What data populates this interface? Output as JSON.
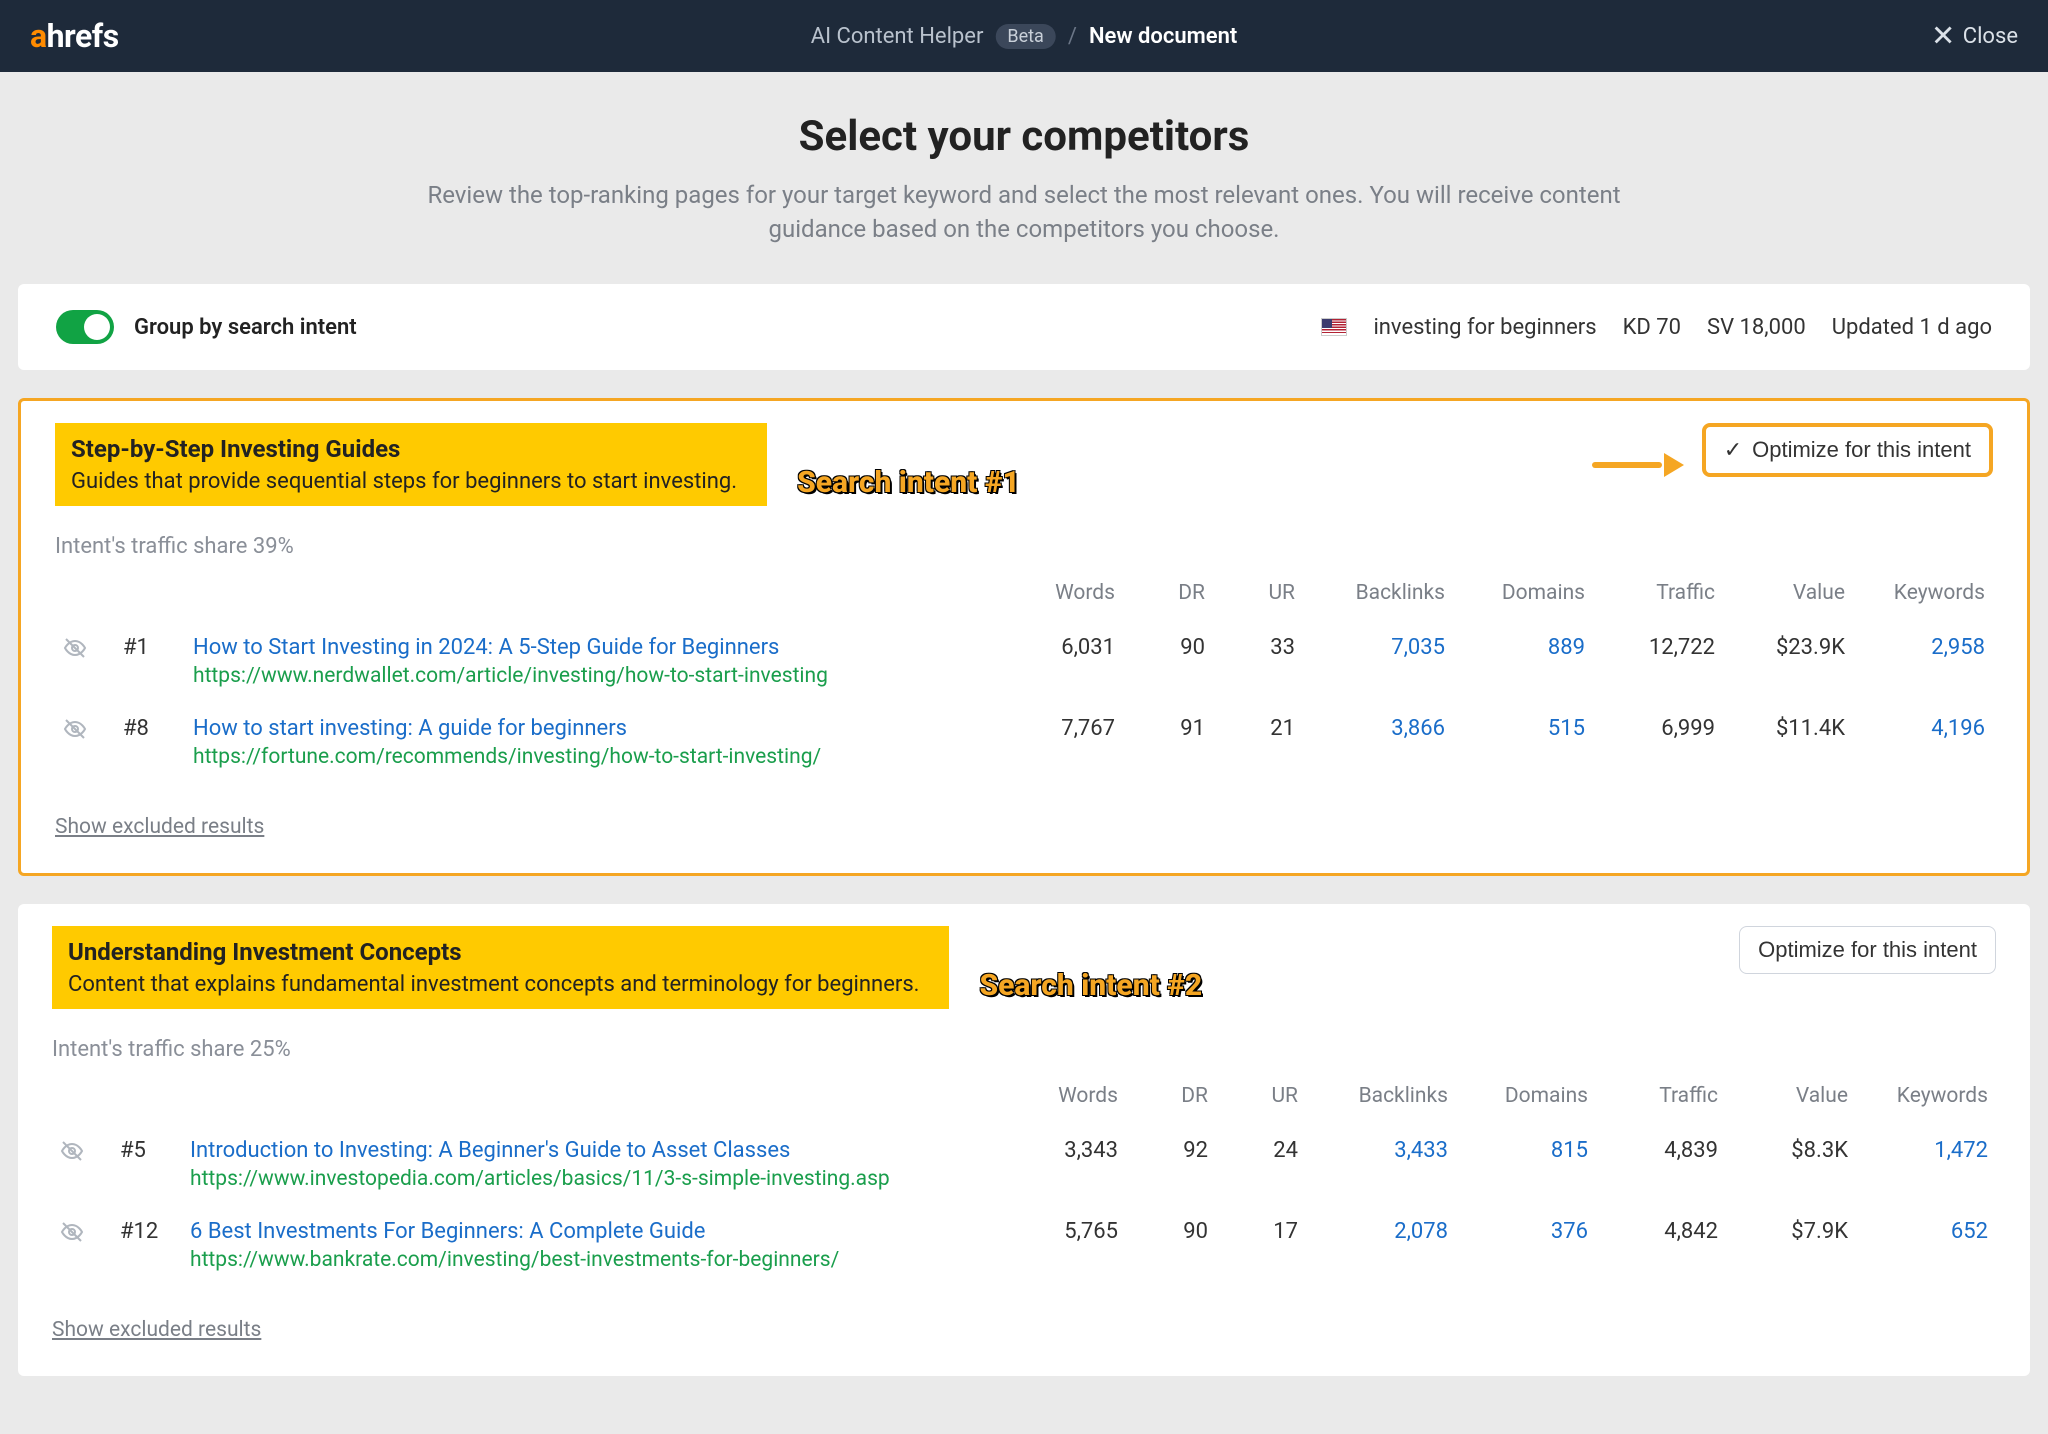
{
  "header": {
    "logo_a": "a",
    "logo_rest": "hrefs",
    "breadcrumb_tool": "AI Content Helper",
    "beta": "Beta",
    "breadcrumb_current": "New document",
    "close": "Close"
  },
  "hero": {
    "title": "Select your competitors",
    "subtitle": "Review the top-ranking pages for your target keyword and select the most relevant ones. You will receive content guidance based on the competitors you choose."
  },
  "controls": {
    "toggle_label": "Group by search intent",
    "keyword": "investing for beginners",
    "kd": "KD 70",
    "sv": "SV 18,000",
    "updated": "Updated 1 d ago"
  },
  "columns": {
    "words": "Words",
    "dr": "DR",
    "ur": "UR",
    "backlinks": "Backlinks",
    "domains": "Domains",
    "traffic": "Traffic",
    "value": "Value",
    "keywords": "Keywords"
  },
  "optimize_label": "Optimize for this intent",
  "show_excluded": "Show excluded results",
  "annotations": {
    "intent1": "Search intent #1",
    "intent2": "Search intent #2"
  },
  "intents": [
    {
      "title": "Step-by-Step Investing Guides",
      "desc": "Guides that provide sequential steps for beginners to start investing.",
      "traffic_share": "Intent's traffic share 39%",
      "rows": [
        {
          "rank": "#1",
          "title": "How to Start Investing in 2024: A 5-Step Guide for Beginners",
          "url": "https://www.nerdwallet.com/article/investing/how-to-start-investing",
          "words": "6,031",
          "dr": "90",
          "ur": "33",
          "backlinks": "7,035",
          "domains": "889",
          "traffic": "12,722",
          "value": "$23.9K",
          "keywords": "2,958"
        },
        {
          "rank": "#8",
          "title": "How to start investing: A guide for beginners",
          "url": "https://fortune.com/recommends/investing/how-to-start-investing/",
          "words": "7,767",
          "dr": "91",
          "ur": "21",
          "backlinks": "3,866",
          "domains": "515",
          "traffic": "6,999",
          "value": "$11.4K",
          "keywords": "4,196"
        }
      ]
    },
    {
      "title": "Understanding Investment Concepts",
      "desc": "Content that explains fundamental investment concepts and terminology for beginners.",
      "traffic_share": "Intent's traffic share 25%",
      "rows": [
        {
          "rank": "#5",
          "title": "Introduction to Investing: A Beginner's Guide to Asset Classes",
          "url": "https://www.investopedia.com/articles/basics/11/3-s-simple-investing.asp",
          "words": "3,343",
          "dr": "92",
          "ur": "24",
          "backlinks": "3,433",
          "domains": "815",
          "traffic": "4,839",
          "value": "$8.3K",
          "keywords": "1,472"
        },
        {
          "rank": "#12",
          "title": "6 Best Investments For Beginners: A Complete Guide",
          "url": "https://www.bankrate.com/investing/best-investments-for-beginners/",
          "words": "5,765",
          "dr": "90",
          "ur": "17",
          "backlinks": "2,078",
          "domains": "376",
          "traffic": "4,842",
          "value": "$7.9K",
          "keywords": "652"
        }
      ]
    }
  ]
}
